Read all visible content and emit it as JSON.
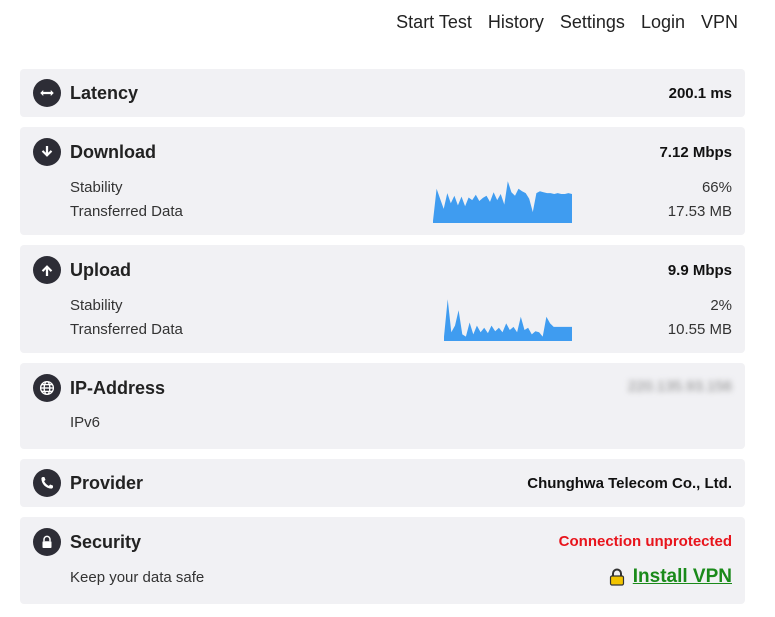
{
  "nav": {
    "items": [
      "Start Test",
      "History",
      "Settings",
      "Login",
      "VPN"
    ]
  },
  "latency": {
    "title": "Latency",
    "value": "200.1 ms",
    "icon": "arrows-horizontal-icon"
  },
  "download": {
    "title": "Download",
    "value": "7.12 Mbps",
    "icon": "arrow-down-icon",
    "stability_label": "Stability",
    "stability_value": "66%",
    "transferred_label": "Transferred Data",
    "transferred_value": "17.53 MB",
    "sparkline": [
      0.05,
      0.78,
      0.55,
      0.32,
      0.68,
      0.45,
      0.62,
      0.4,
      0.6,
      0.38,
      0.58,
      0.52,
      0.64,
      0.5,
      0.57,
      0.62,
      0.48,
      0.7,
      0.52,
      0.66,
      0.42,
      0.95,
      0.7,
      0.62,
      0.78,
      0.72,
      0.68,
      0.55,
      0.25,
      0.68,
      0.72,
      0.7,
      0.68,
      0.68,
      0.66,
      0.68,
      0.66,
      0.66,
      0.68,
      0.66
    ],
    "color": "#3f9cf0"
  },
  "upload": {
    "title": "Upload",
    "value": "9.9 Mbps",
    "icon": "arrow-up-icon",
    "stability_label": "Stability",
    "stability_value": "2%",
    "transferred_label": "Transferred Data",
    "transferred_value": "10.55 MB",
    "sparkline": [
      0.1,
      0.95,
      0.2,
      0.35,
      0.7,
      0.15,
      0.1,
      0.42,
      0.15,
      0.35,
      0.2,
      0.3,
      0.18,
      0.35,
      0.22,
      0.3,
      0.2,
      0.4,
      0.25,
      0.32,
      0.2,
      0.55,
      0.25,
      0.3,
      0.15,
      0.22,
      0.2,
      0.1,
      0.55,
      0.4,
      0.32,
      0.32,
      0.32,
      0.32,
      0.32,
      0.32
    ],
    "color": "#3f9cf0"
  },
  "ip": {
    "title": "IP-Address",
    "value": "220.135.93.156",
    "icon": "globe-icon",
    "version_label": "IPv6"
  },
  "provider": {
    "title": "Provider",
    "value": "Chunghwa Telecom Co., Ltd.",
    "icon": "phone-icon"
  },
  "security": {
    "title": "Security",
    "status": "Connection unprotected",
    "icon": "lock-icon",
    "sub_label": "Keep your data safe",
    "cta_label": "Install VPN",
    "status_color": "#e8141c",
    "cta_color": "#1a8a1a"
  }
}
